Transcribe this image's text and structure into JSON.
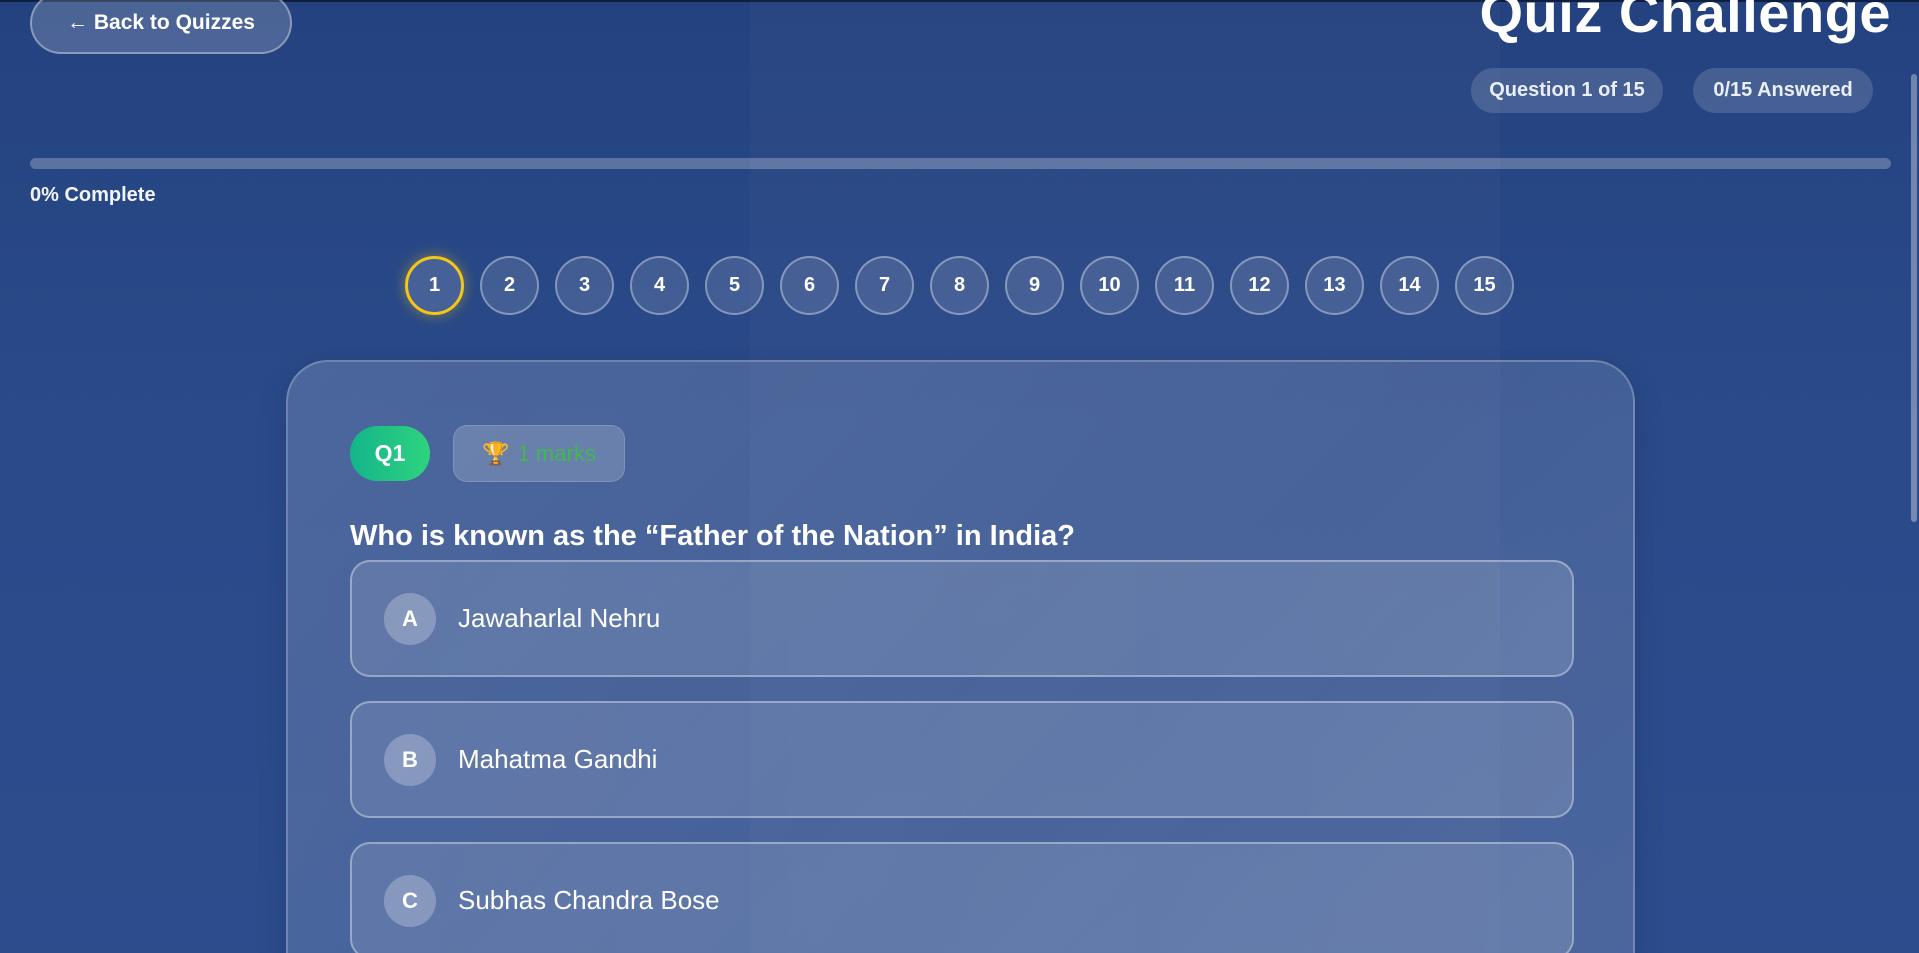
{
  "header": {
    "back_label": "← Back to Quizzes",
    "title": "Quiz Challenge",
    "question_pill": "Question 1 of 15",
    "answered_pill": "0/15 Answered"
  },
  "progress": {
    "percent": 0,
    "label": "0% Complete",
    "fill_color": "#f5c518"
  },
  "question_nav": {
    "active": 1,
    "items": [
      "1",
      "2",
      "3",
      "4",
      "5",
      "6",
      "7",
      "8",
      "9",
      "10",
      "11",
      "12",
      "13",
      "14",
      "15"
    ]
  },
  "question": {
    "number_badge": "Q1",
    "marks_icon": "trophy-icon",
    "marks_label": "1 marks",
    "text": "Who is known as the “Father of the Nation” in India?",
    "options": [
      {
        "letter": "A",
        "text": "Jawaharlal Nehru"
      },
      {
        "letter": "B",
        "text": "Mahatma Gandhi"
      },
      {
        "letter": "C",
        "text": "Subhas Chandra Bose"
      }
    ]
  },
  "colors": {
    "background": "#2a4a8a",
    "accent": "#f5c518",
    "badge_green": "#2ed37f",
    "marks_green": "#3fb950"
  }
}
